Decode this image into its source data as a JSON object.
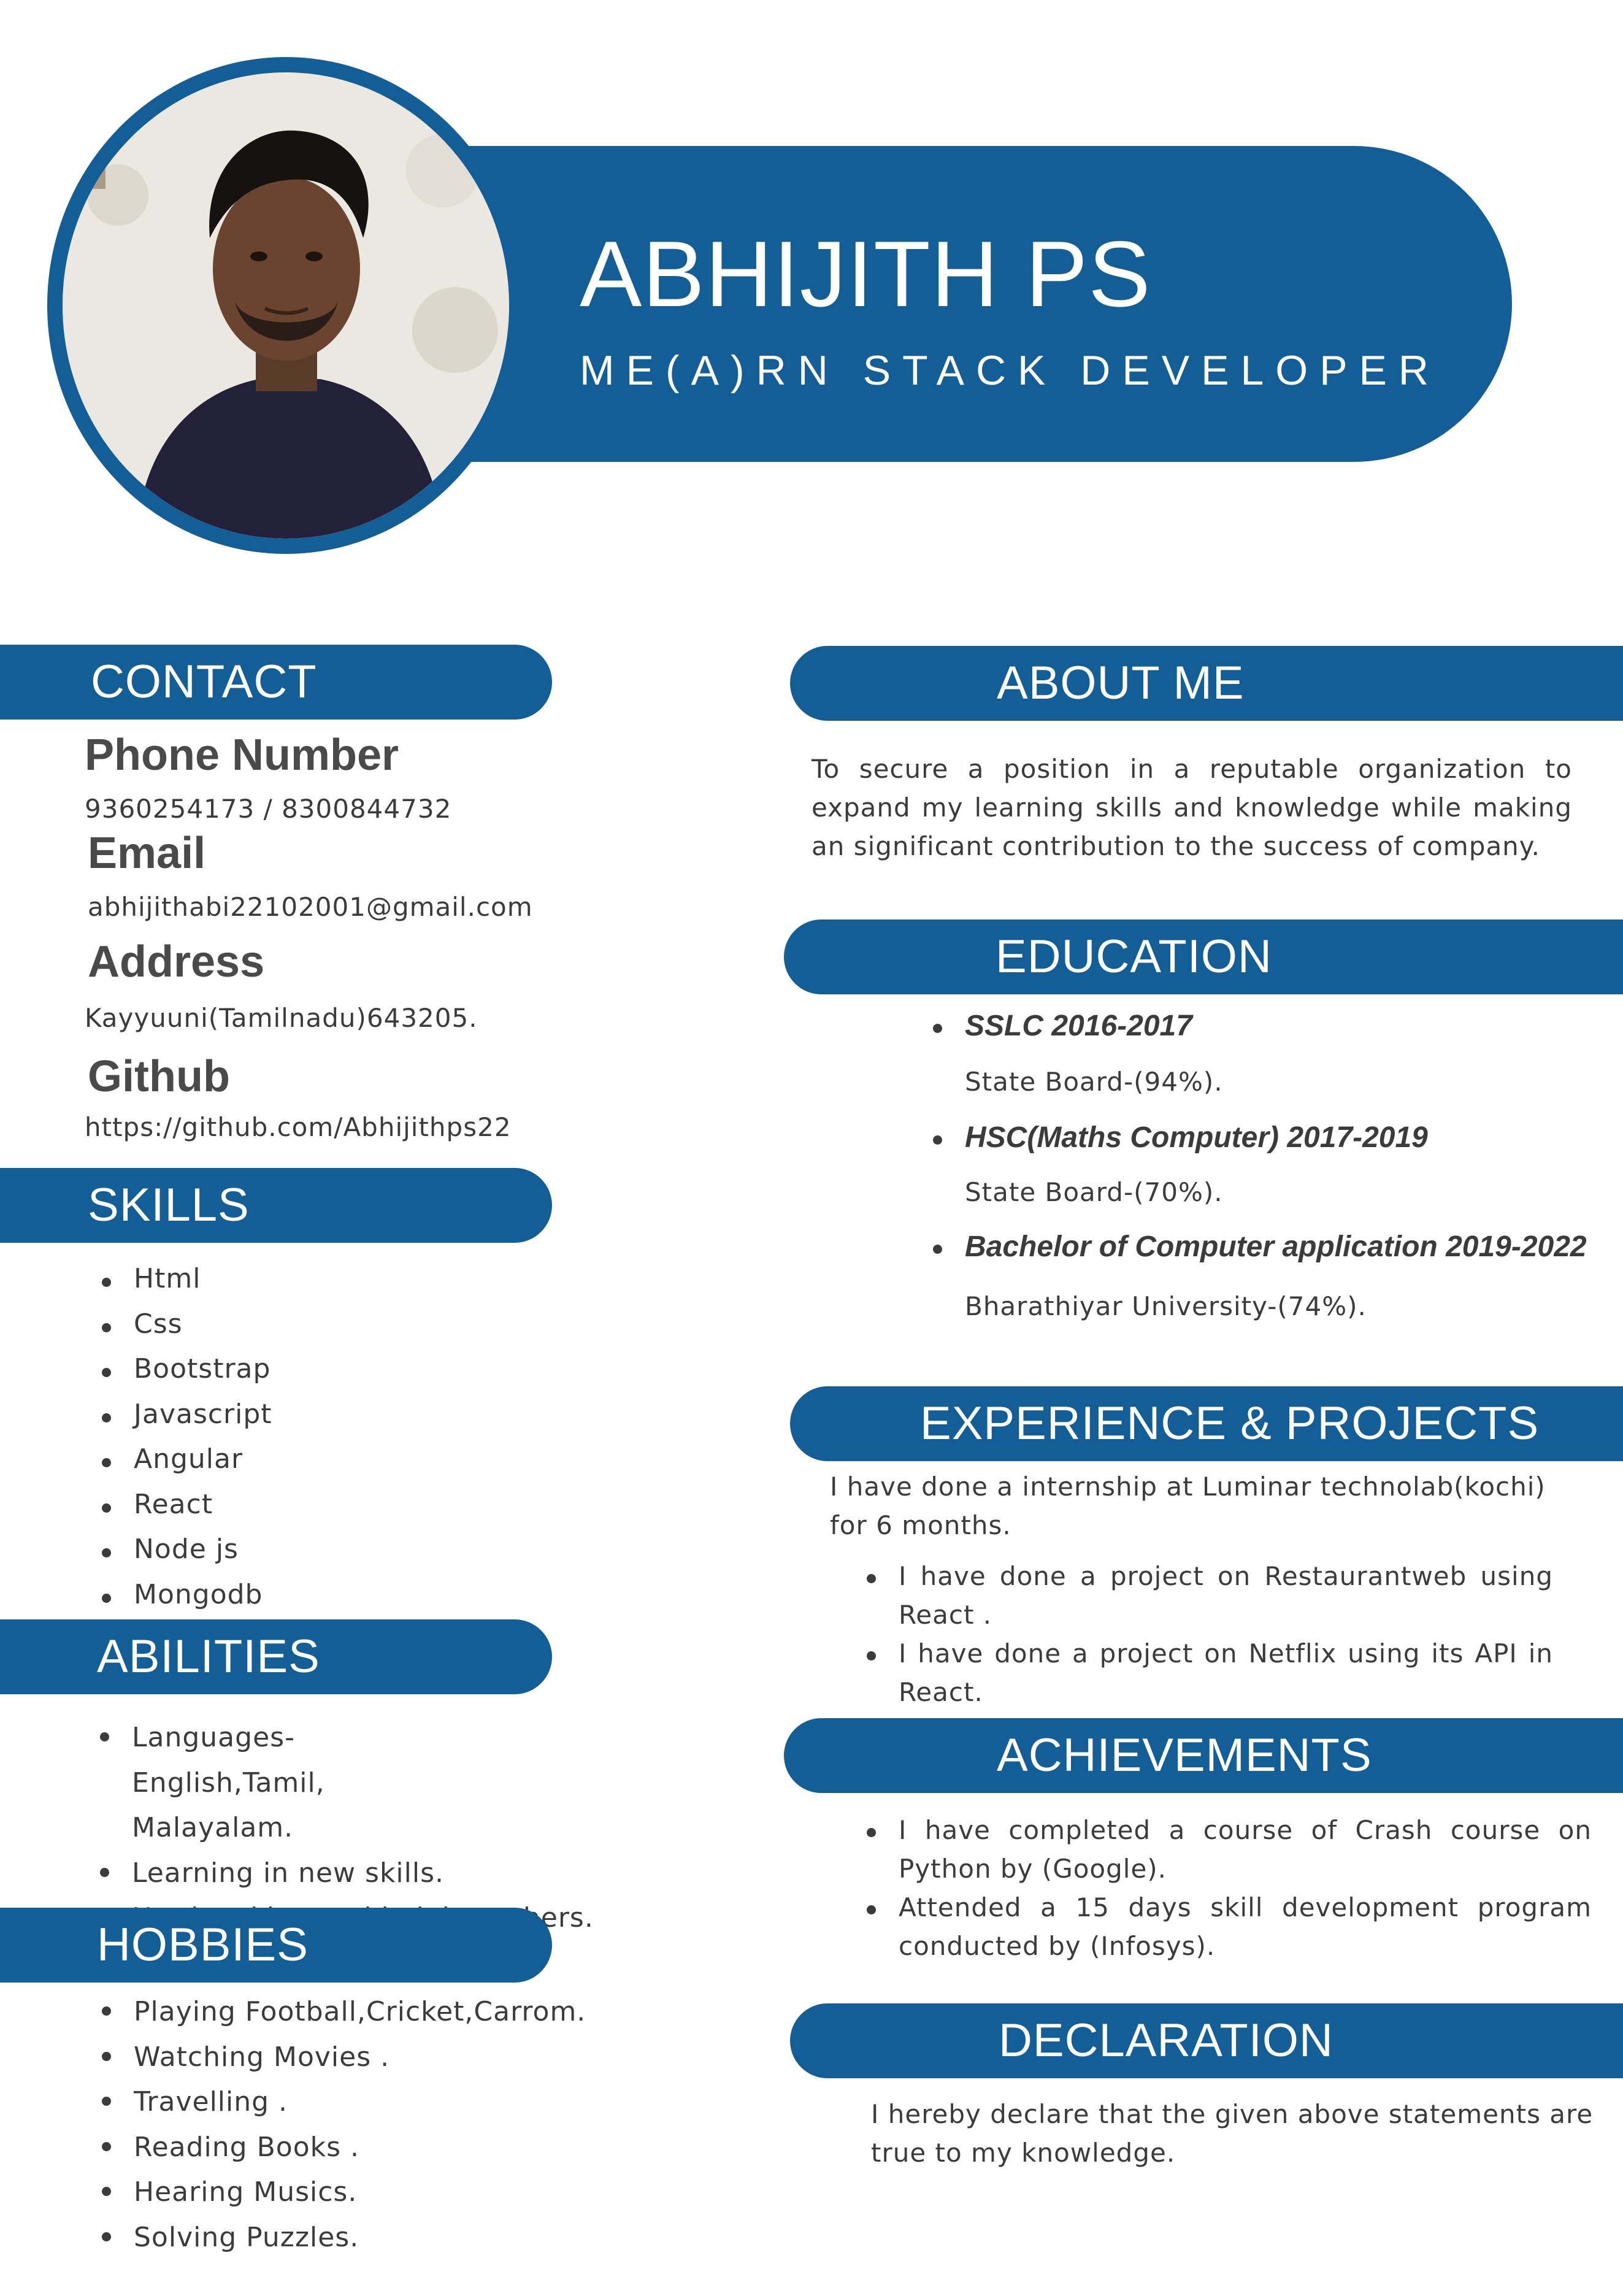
{
  "header": {
    "name": "ABHIJITH PS",
    "role": "ME(A)RN STACK DEVELOPER"
  },
  "colors": {
    "accent": "#135e96",
    "text": "#3b3b3b"
  },
  "contact": {
    "title": "CONTACT",
    "phone_label": "Phone Number",
    "phone_value": "9360254173  /  8300844732",
    "email_label": "Email",
    "email_value": "abhijithabi22102001@gmail.com",
    "address_label": "Address",
    "address_value": "Kayyuuni(Tamilnadu)643205.",
    "github_label": "Github",
    "github_value": "https://github.com/Abhijithps22"
  },
  "skills": {
    "title": "SKILLS",
    "items": [
      "Html",
      "Css",
      "Bootstrap",
      "Javascript",
      "Angular",
      "React",
      "Node js",
      "Mongodb"
    ]
  },
  "abilities": {
    "title": "ABILITIES",
    "items": [
      "Languages-English,Tamil, Malayalam.",
      "Learning in new skills.",
      "Hardworking and helping others."
    ]
  },
  "hobbies": {
    "title": "HOBBIES",
    "items": [
      "Playing Football,Cricket,Carrom.",
      "Watching Movies .",
      "Travelling .",
      "Reading Books .",
      "Hearing Musics.",
      "Solving Puzzles."
    ]
  },
  "about": {
    "title": "ABOUT ME",
    "text": "To secure a position in a reputable organization to expand my learning skills and knowledge  while making an significant contribution to the success of company."
  },
  "education": {
    "title": "EDUCATION",
    "items": [
      {
        "degree": "SSLC 2016-2017",
        "detail": "State Board-(94%)."
      },
      {
        "degree": "HSC(Maths Computer) 2017-2019",
        "detail": "State Board-(70%)."
      },
      {
        "degree": "Bachelor of Computer application 2019-2022",
        "detail": "Bharathiyar University-(74%)."
      }
    ]
  },
  "experience": {
    "title": "EXPERIENCE  &  PROJECTS",
    "intro": "I have done a internship at Luminar technolab(kochi) for 6 months.",
    "items": [
      "I have done a project on Restaurantweb using React .",
      "I have done a project on Netflix using its API in React."
    ]
  },
  "achievements": {
    "title": "ACHIEVEMENTS",
    "items": [
      "I have completed a course of Crash course on Python by (Google).",
      "Attended a 15 days skill development program conducted by (Infosys)."
    ]
  },
  "declaration": {
    "title": "DECLARATION",
    "text": "I hereby declare that the given above statements are true to my knowledge."
  }
}
